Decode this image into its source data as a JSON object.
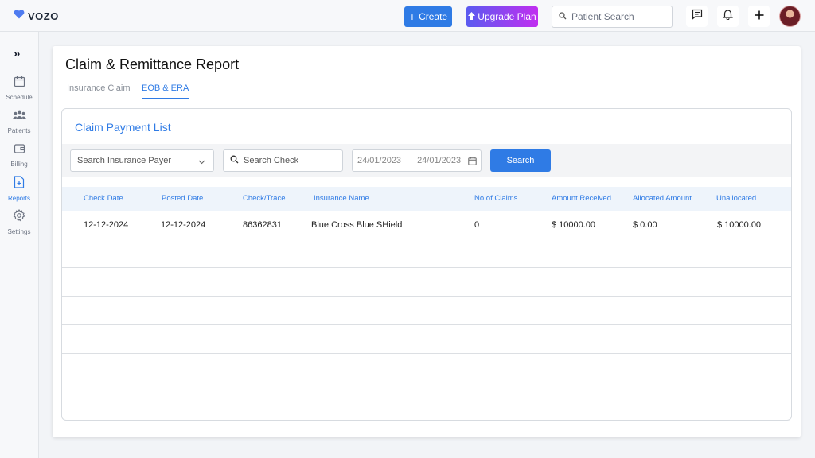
{
  "topbar": {
    "logo_text": "VOZO",
    "create_label": "Create",
    "upgrade_label": "Upgrade Plan",
    "search_placeholder": "Patient Search"
  },
  "sidebar": {
    "items": [
      {
        "label": "Schedule",
        "icon": "calendar-icon"
      },
      {
        "label": "Patients",
        "icon": "users-icon"
      },
      {
        "label": "Billing",
        "icon": "wallet-icon"
      },
      {
        "label": "Reports",
        "icon": "report-icon"
      },
      {
        "label": "Settings",
        "icon": "gear-icon"
      }
    ]
  },
  "page": {
    "title": "Claim & Remittance Report",
    "tabs": [
      "Insurance Claim",
      "EOB & ERA"
    ],
    "active_tab": "EOB & ERA"
  },
  "panel": {
    "title": "Claim Payment List",
    "filters": {
      "payer_placeholder": "Search Insurance Payer",
      "check_placeholder": "Search Check",
      "date_from": "24/01/2023",
      "date_to": "24/01/2023",
      "search_label": "Search"
    }
  },
  "table": {
    "columns": [
      "Check Date",
      "Posted Date",
      "Check/Trace",
      "Insurance Name",
      "No.of Claims",
      "Amount Received",
      "Allocated Amount",
      "Unallocated"
    ],
    "rows": [
      [
        "12-12-2024",
        "12-12-2024",
        "86362831",
        "Blue Cross Blue SHield",
        "0",
        "$ 10000.00",
        "$ 0.00",
        "$ 10000.00"
      ]
    ]
  },
  "colors": {
    "accent": "#2f7be5",
    "upgrade_gradient_start": "#5b5bf0",
    "upgrade_gradient_end": "#c12ef0",
    "header_bg": "#eef4fb"
  }
}
